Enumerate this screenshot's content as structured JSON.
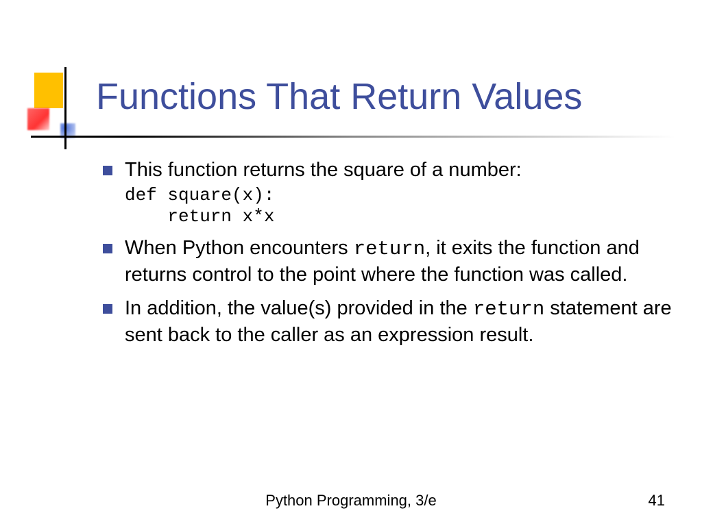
{
  "title": "Functions That Return Values",
  "bullets": {
    "b1_text": "This function returns the square of a number:",
    "b1_code": "def square(x):\n    return x*x",
    "b2_pre": "When Python encounters ",
    "b2_code": "return",
    "b2_post": ", it exits the function and returns control to the point where the function was called.",
    "b3_pre": "In addition, the value(s) provided in the ",
    "b3_code": "return",
    "b3_post": " statement are sent back to the caller as an expression result."
  },
  "footer": "Python Programming, 3/e",
  "page": "41"
}
